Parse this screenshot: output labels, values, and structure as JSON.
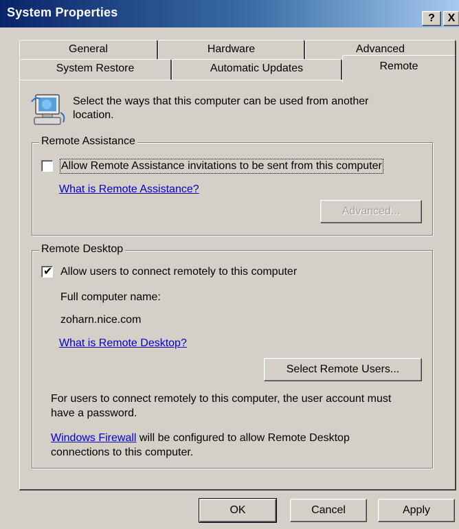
{
  "window": {
    "title": "System Properties",
    "help_label": "?",
    "close_label": "X"
  },
  "tabs": {
    "row1": [
      {
        "label": "General"
      },
      {
        "label": "Hardware"
      },
      {
        "label": "Advanced"
      }
    ],
    "row2": [
      {
        "label": "System Restore"
      },
      {
        "label": "Automatic Updates"
      },
      {
        "label": "Remote"
      }
    ],
    "active": "Remote"
  },
  "intro": {
    "icon": "remote-computer-icon",
    "line1": "Select the ways that this computer can be used from another",
    "line2": "location."
  },
  "remote_assistance": {
    "legend": "Remote Assistance",
    "checkbox_label": "Allow Remote Assistance invitations to be sent from this computer",
    "checked": false,
    "help_link": "What is Remote Assistance?",
    "advanced_button": "Advanced..."
  },
  "remote_desktop": {
    "legend": "Remote Desktop",
    "checkbox_label": "Allow users to connect remotely to this computer",
    "checked": true,
    "check_glyph": "✔",
    "computer_name_label": "Full computer name:",
    "computer_name": "zoharn.nice.com",
    "help_link": "What is Remote Desktop?",
    "select_users_button": "Select Remote Users...",
    "password_note_line1": "For users to connect remotely to this computer, the user account must",
    "password_note_line2": "have a password.",
    "firewall_link": "Windows Firewall",
    "firewall_note_rest": " will be configured to allow Remote Desktop",
    "firewall_note_line2": "connections to this computer."
  },
  "footer": {
    "ok": "OK",
    "cancel": "Cancel",
    "apply": "Apply"
  }
}
